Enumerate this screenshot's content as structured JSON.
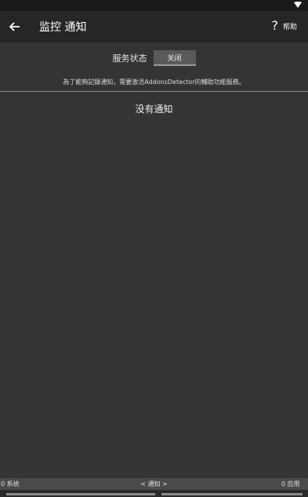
{
  "app_bar": {
    "back_icon": "arrow-left-icon",
    "title": "监控 通知",
    "help_icon": "question-mark-icon",
    "help_label": "帮助"
  },
  "service": {
    "label": "服务状态",
    "toggle_value": "关闭",
    "note": "為了能夠記錄通知，需要激活AddonsDetector的輔助功能服務。"
  },
  "content": {
    "empty_message": "没有通知"
  },
  "bottom_nav": {
    "left": "0 系统",
    "center": "< 通知 >",
    "right": "0 应用"
  },
  "colors": {
    "background": "#343434",
    "app_bar": "#262626",
    "toggle": "#5a5a5a",
    "bottom_bar": "#4a4a4a"
  }
}
